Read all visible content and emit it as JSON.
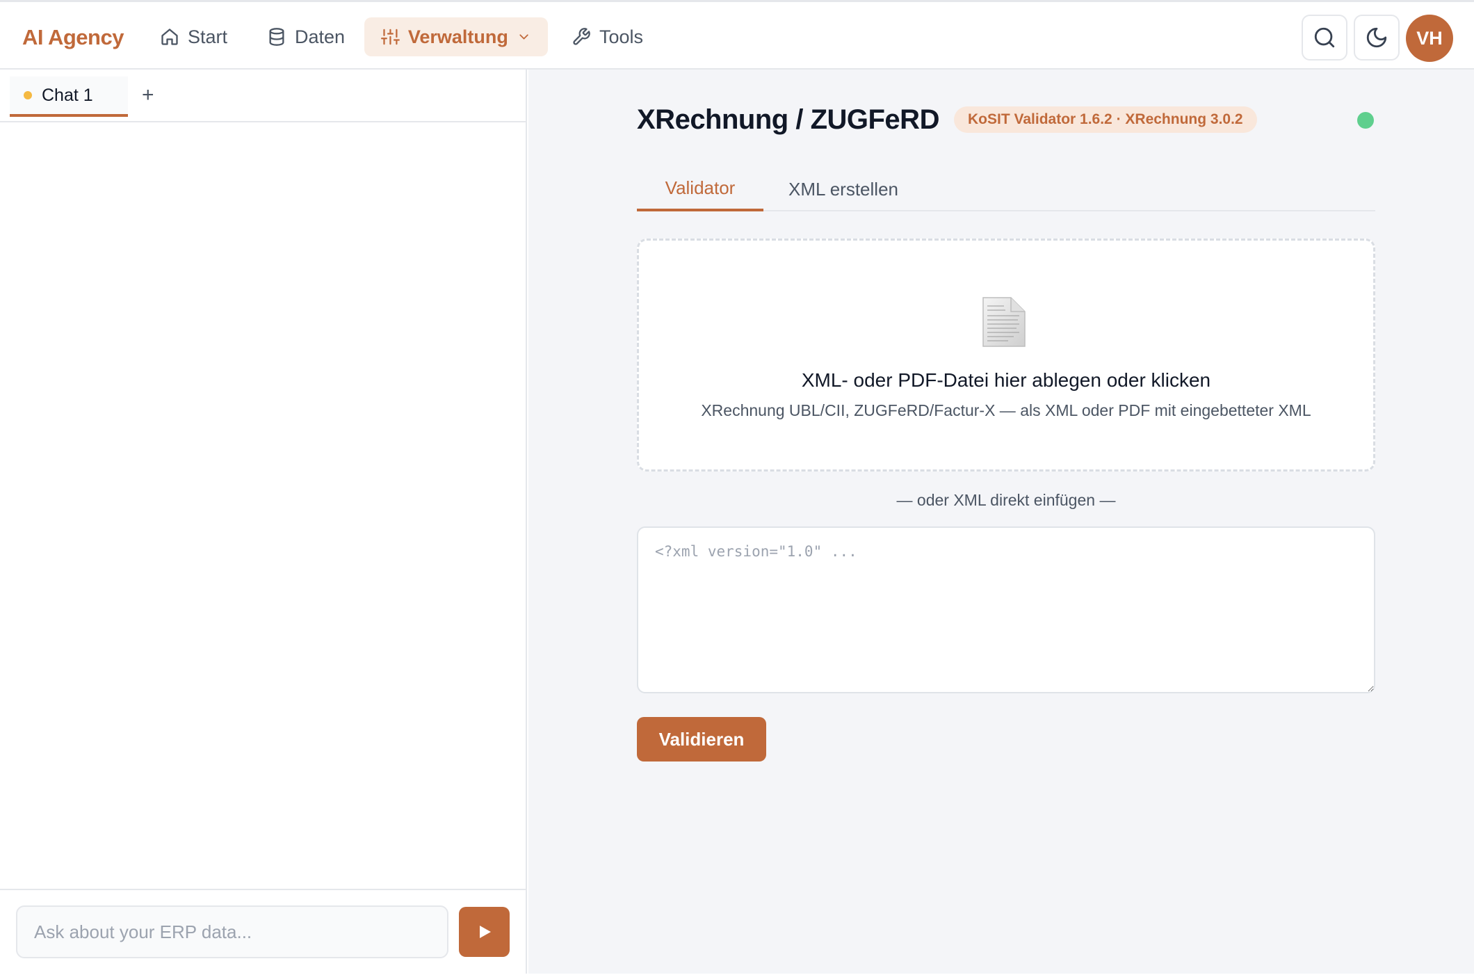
{
  "app": {
    "brand": "AI Agency",
    "accent_color": "#c0693a"
  },
  "nav": {
    "items": [
      {
        "label": "Start",
        "icon": "home-icon"
      },
      {
        "label": "Daten",
        "icon": "database-icon"
      },
      {
        "label": "Verwaltung",
        "icon": "sliders-icon",
        "active": true
      },
      {
        "label": "Tools",
        "icon": "wrench-icon"
      }
    ],
    "avatar_initials": "VH"
  },
  "chat": {
    "tabs": [
      {
        "label": "Chat 1"
      }
    ],
    "add_tab_label": "+",
    "input_placeholder": "Ask about your ERP data..."
  },
  "main": {
    "title": "XRechnung / ZUGFeRD",
    "version_badge": "KoSIT Validator 1.6.2 · XRechnung 3.0.2",
    "status_color": "#5fcf8e",
    "tabs": [
      {
        "label": "Validator",
        "active": true
      },
      {
        "label": "XML erstellen",
        "active": false
      }
    ],
    "dropzone": {
      "title": "XML- oder PDF-Datei hier ablegen oder klicken",
      "subtitle": "XRechnung UBL/CII, ZUGFeRD/Factur-X — als XML oder PDF mit eingebetteter XML"
    },
    "divider_text": "— oder XML direkt einfügen —",
    "xml_placeholder": "<?xml version=\"1.0\" ...",
    "validate_label": "Validieren"
  }
}
